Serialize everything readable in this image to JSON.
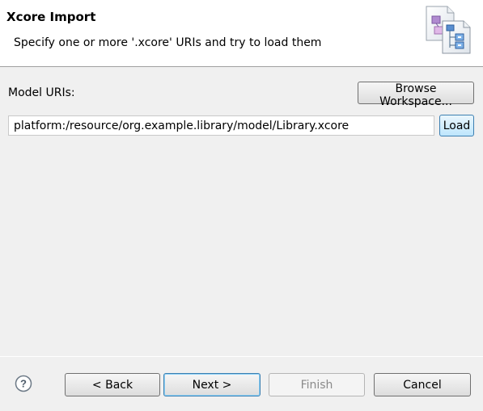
{
  "header": {
    "title": "Xcore Import",
    "description": "Specify one or more '.xcore' URIs and try to load them",
    "icon": "xcore-import-wizard-icon"
  },
  "form": {
    "model_uris_label": "Model URIs:",
    "browse_workspace_label": "Browse Workspace...",
    "uri_value": "platform:/resource/org.example.library/model/Library.xcore",
    "load_label": "Load"
  },
  "footer": {
    "help_icon": "question-mark-icon",
    "back_label": "< Back",
    "next_label": "Next >",
    "finish_label": "Finish",
    "cancel_label": "Cancel"
  },
  "colors": {
    "dialog_background": "#f0f0f0",
    "banner_background": "#ffffff",
    "focus_border": "#3c7fb1",
    "disabled_text": "#8a8a8a"
  }
}
